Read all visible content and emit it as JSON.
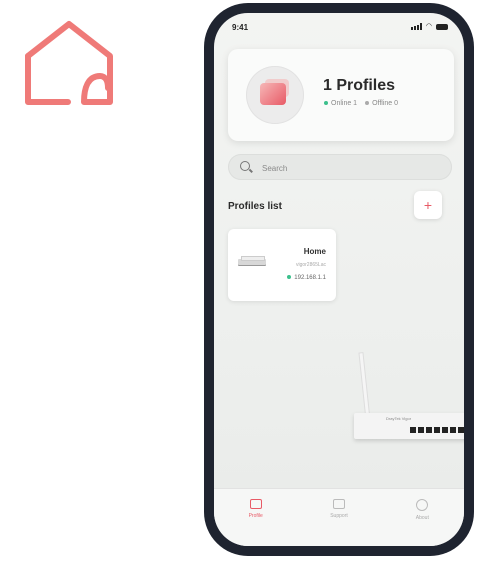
{
  "status_bar": {
    "time": "9:41"
  },
  "profile_summary": {
    "title": "1 Profiles",
    "online_label": "Online 1",
    "offline_label": "Offline 0"
  },
  "search": {
    "placeholder": "Search"
  },
  "profiles_list": {
    "title": "Profiles list",
    "add_label": "+",
    "items": [
      {
        "name": "Home",
        "subtitle": "vigor2865Lac",
        "ip": "192.168.1.1"
      }
    ]
  },
  "tabbar": {
    "tabs": [
      {
        "label": "Profile",
        "icon": "folder-icon",
        "active": true
      },
      {
        "label": "Support",
        "icon": "document-icon",
        "active": false
      },
      {
        "label": "About",
        "icon": "info-icon",
        "active": false
      }
    ]
  },
  "router_illustration": {
    "label": "DrayTek Vigor"
  },
  "colors": {
    "accent": "#e85a66",
    "logo": "#ef7a78",
    "online": "#3cc08c",
    "offline": "#aaaaaa",
    "phone_frame": "#1f2430"
  },
  "logo": {
    "icon": "home-icon"
  }
}
